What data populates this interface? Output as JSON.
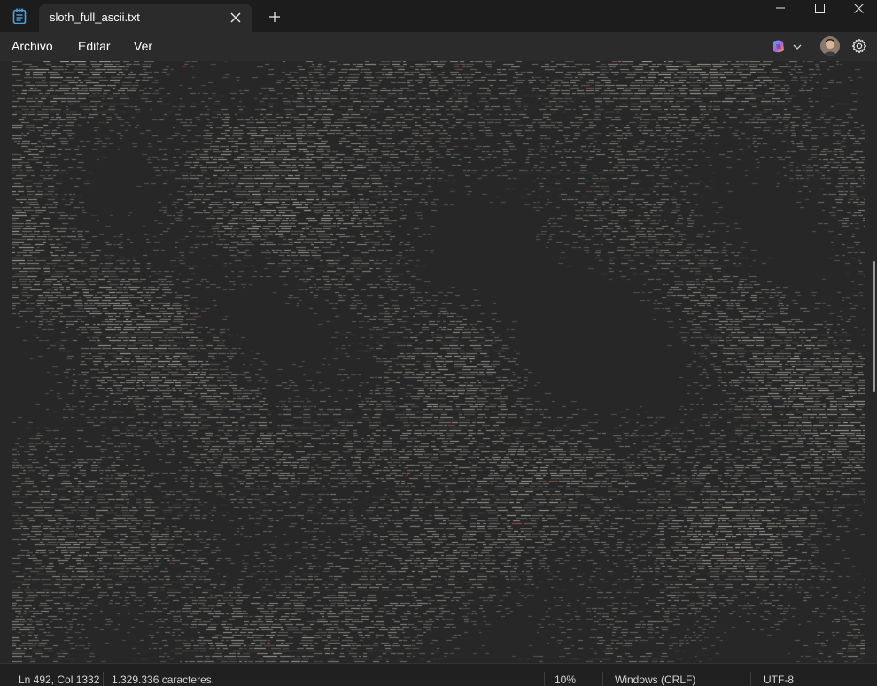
{
  "tab": {
    "title": "sloth_full_ascii.txt",
    "close_icon": "close-icon",
    "new_tab_icon": "plus-icon"
  },
  "menu": {
    "items": [
      "Archivo",
      "Editar",
      "Ver"
    ]
  },
  "status": {
    "position": "Ln 492, Col 1332",
    "characters": "1.329.336 caracteres.",
    "zoom": "10%",
    "line_endings": "Windows (CRLF)",
    "encoding": "UTF-8"
  },
  "colors": {
    "titlebar": "#1c1c1c",
    "tab_active": "#2b2b2b",
    "editor_bg": "#272727",
    "text_light": "#c8c4b8",
    "text_accent": "#c0604e"
  }
}
